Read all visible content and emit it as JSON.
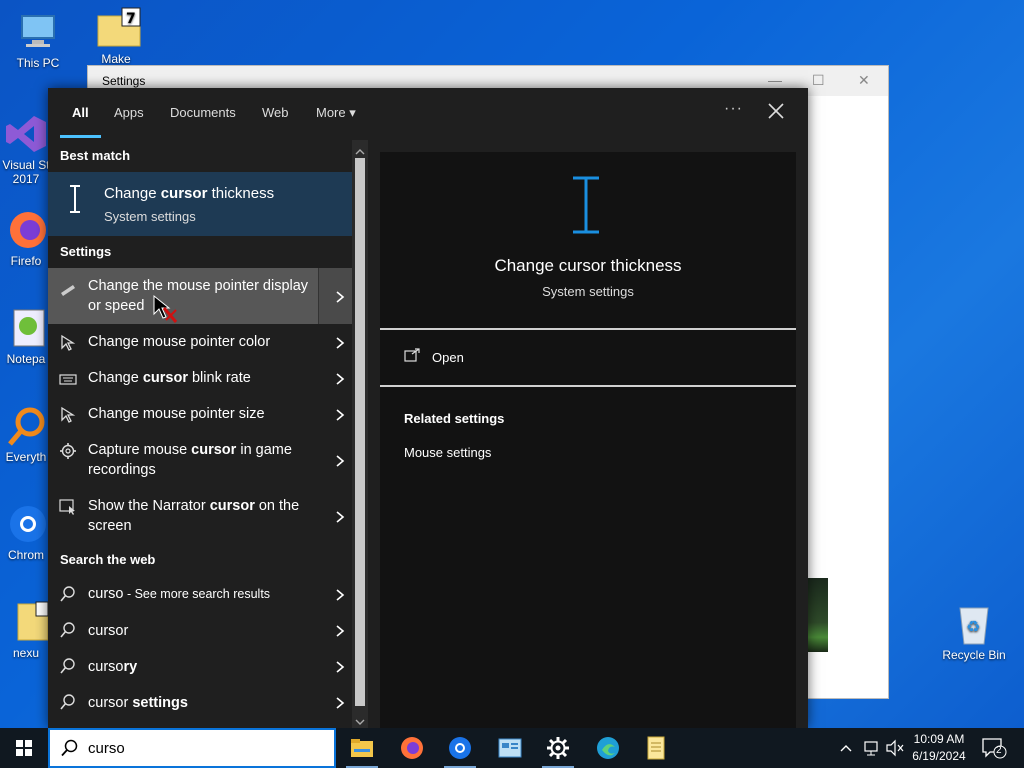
{
  "desktop": {
    "icons": [
      {
        "label": "This PC"
      },
      {
        "label": "Make"
      },
      {
        "label": "Visual St 2017"
      },
      {
        "label": "Firefo"
      },
      {
        "label": "Notepa"
      },
      {
        "label": "Everyth"
      },
      {
        "label": "Chrom"
      },
      {
        "label": "nexu"
      },
      {
        "label": "Recycle Bin"
      }
    ]
  },
  "background_window": {
    "title": "Settings",
    "minimize": "—",
    "maximize": "☐",
    "close": "✕"
  },
  "search_panel": {
    "tabs": [
      {
        "label": "All",
        "active": true
      },
      {
        "label": "Apps"
      },
      {
        "label": "Documents"
      },
      {
        "label": "Web"
      },
      {
        "label": "More ▾"
      }
    ],
    "more_options": "···",
    "sections": {
      "best_match": "Best match",
      "settings": "Settings",
      "search_web": "Search the web"
    },
    "best_match": {
      "title_pre": "Change ",
      "title_bold": "cursor",
      "title_post": " thickness",
      "subtitle": "System settings"
    },
    "settings_results": [
      {
        "pre": "Change the mouse pointer display or speed",
        "bold": "",
        "post": "",
        "icon": "mouse-icon",
        "highlight": true
      },
      {
        "pre": "Change mouse pointer color",
        "bold": "",
        "post": "",
        "icon": "pointer-icon"
      },
      {
        "pre": "Change ",
        "bold": "cursor",
        "post": " blink rate",
        "icon": "keyboard-icon"
      },
      {
        "pre": "Change mouse pointer size",
        "bold": "",
        "post": "",
        "icon": "pointer-icon"
      },
      {
        "pre": "Capture mouse ",
        "bold": "cursor",
        "post": " in game recordings",
        "icon": "gear-icon"
      },
      {
        "pre": "Show the Narrator ",
        "bold": "cursor",
        "post": " on the screen",
        "icon": "narrator-icon"
      }
    ],
    "web_results": [
      {
        "main": "curso",
        "bold": "",
        "extra": " - See more search results"
      },
      {
        "main": "cursor",
        "bold": "",
        "extra": ""
      },
      {
        "main": "curso",
        "bold": "ry",
        "extra": ""
      },
      {
        "main": "cursor",
        "bold": " settings",
        "extra": ""
      }
    ],
    "preview": {
      "title": "Change cursor thickness",
      "subtitle": "System settings",
      "open_label": "Open",
      "related_heading": "Related settings",
      "related_link": "Mouse settings"
    }
  },
  "taskbar": {
    "search_value": "curso",
    "apps": [
      "file-explorer-icon",
      "firefox-icon",
      "chrome-icon",
      "control-panel-icon",
      "settings-icon",
      "edge-icon",
      "notepad-icon"
    ],
    "time": "10:09 AM",
    "date": "6/19/2024",
    "notification_count": "2"
  },
  "colors": {
    "accent": "#4cc2ff",
    "best_match_bg": "#1e3a54",
    "panel_bg": "#1f1f1f",
    "preview_bg": "#121212",
    "cursor_blue": "#1a8fe0"
  }
}
